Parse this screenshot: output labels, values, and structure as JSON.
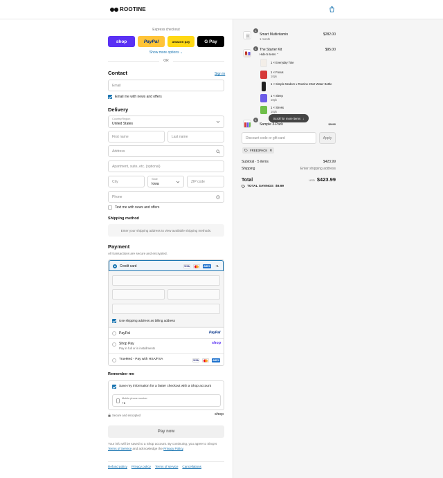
{
  "header": {
    "brand": "ROOTINE"
  },
  "express": {
    "label": "Express checkout",
    "buttons": {
      "shop": "shop",
      "paypal": "PayPal",
      "amazon": "amazon pay",
      "gpay": "G Pay"
    },
    "more": "Show more options",
    "or": "OR"
  },
  "contact": {
    "title": "Contact",
    "sign_in": "Sign in",
    "email_placeholder": "Email",
    "newsletter_label": "Email me with news and offers"
  },
  "delivery": {
    "title": "Delivery",
    "country_label": "Country/Region",
    "country_value": "United States",
    "first_name": "First name",
    "last_name": "Last name",
    "address": "Address",
    "apartment": "Apartment, suite, etc. (optional)",
    "city": "City",
    "state_label": "State",
    "state_value": "Iowa",
    "zip": "ZIP code",
    "phone": "Phone",
    "text_label": "Text me with news and offers"
  },
  "shipping": {
    "title": "Shipping method",
    "message": "Enter your shipping address to view available shipping methods."
  },
  "payment": {
    "title": "Payment",
    "note": "All transactions are secure and encrypted.",
    "credit_card": "Credit card",
    "more_cards": "+1",
    "billing_label": "Use shipping address as billing address",
    "paypal": "PayPal",
    "paypal_logo": "PayPal",
    "shop_pay": "Shop Pay",
    "shop_pay_sub": "Pay in full or in installments",
    "shop_logo": "shop",
    "truemed": "TrueMed - Pay with HSA/FSA",
    "card_logos": {
      "visa": "VISA",
      "amex": "AMEX"
    }
  },
  "remember": {
    "title": "Remember me",
    "save_label": "Save my information for a faster checkout with a Shop account",
    "phone_label": "Mobile phone number",
    "phone_value": "+1",
    "secure": "Secure and encrypted",
    "shop_logo": "shop"
  },
  "pay_now": "Pay now",
  "legal": {
    "text1": "Your info will be saved to a Shop account. By continuing, you agree to Shop's",
    "terms": "Terms of Service",
    "text2": "and acknowledge the",
    "privacy": "Privacy Policy",
    "end": "."
  },
  "footer": [
    "Refund policy",
    "Privacy policy",
    "Terms of service",
    "Cancellations"
  ],
  "cart": {
    "items": [
      {
        "name": "Smart Multivitamin",
        "sub": "1 month",
        "price": "$282.00",
        "qty": "1"
      },
      {
        "name": "The Starter Kit",
        "sub": "Hide 5 items",
        "price": "$95.00",
        "qty": "1"
      }
    ],
    "kit": [
      {
        "name": "1 × Everyday Tote",
        "sub": ""
      },
      {
        "name": "1 × Focus",
        "sub": "10pk"
      },
      {
        "name": "1 × Simple Modern x Rootine 20oz Water Bottle",
        "sub": ""
      },
      {
        "name": "1 × Sleep",
        "sub": "10pk"
      },
      {
        "name": "1 × Stress",
        "sub": "10pk"
      }
    ],
    "sample": {
      "name": "Sample 3-Pack",
      "price": "$9.99",
      "qty": "1"
    },
    "scroll_hint": "Scroll for more items",
    "discount_placeholder": "Discount code or gift card",
    "apply": "Apply",
    "code": "FREE3PACK",
    "subtotal_label": "Subtotal · 5 items",
    "subtotal": "$423.99",
    "shipping_label": "Shipping",
    "shipping_value": "Enter shipping address",
    "total_label": "Total",
    "currency": "USD",
    "total": "$423.99",
    "savings_label": "TOTAL SAVINGS",
    "savings": "$9.99"
  }
}
